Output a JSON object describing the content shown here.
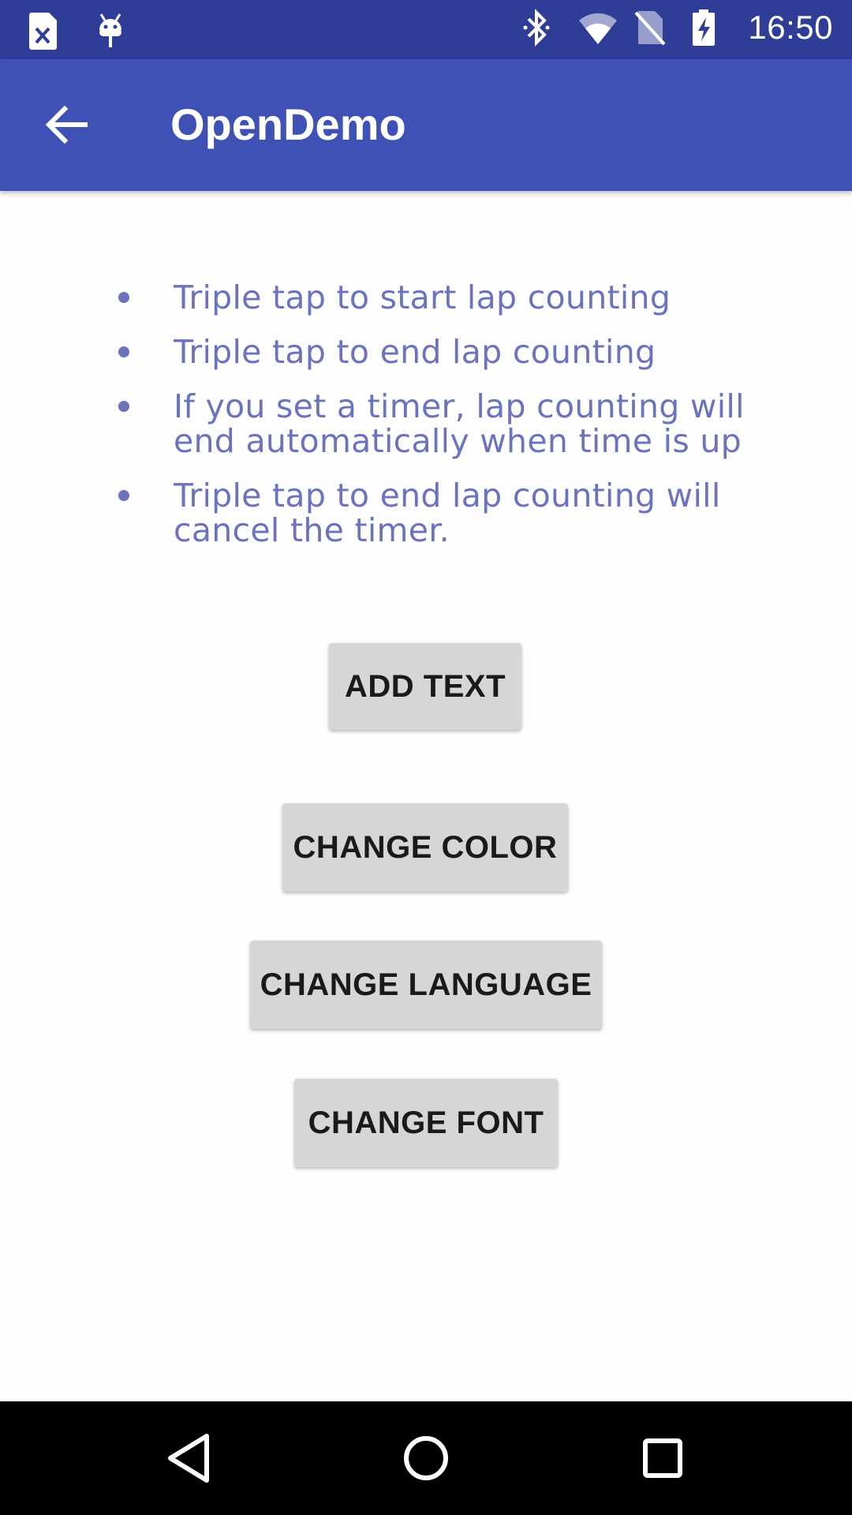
{
  "status_bar": {
    "time": "16:50",
    "icons": [
      "sim-card-icon",
      "android-debug-icon",
      "bluetooth-icon",
      "wifi-icon",
      "no-sim-icon",
      "battery-charging-icon"
    ]
  },
  "app_bar": {
    "title": "OpenDemo",
    "back_icon": "arrow-back-icon"
  },
  "instructions": [
    "Triple tap to start lap counting",
    "Triple tap to end lap counting",
    "If you set a timer, lap counting will end automatically when time is up",
    "Triple tap to end lap counting will cancel the timer."
  ],
  "buttons": {
    "add_text": "ADD TEXT",
    "change_color": "CHANGE COLOR",
    "change_language": "CHANGE LANGUAGE",
    "change_font": "CHANGE FONT"
  },
  "nav_bar": {
    "icons": [
      "nav-back-icon",
      "nav-home-icon",
      "nav-recents-icon"
    ]
  },
  "colors": {
    "status_bar": "#2f3d97",
    "app_bar": "#3f51b5",
    "bullet_text": "#6b73bd",
    "button_bg": "#d6d6d6"
  }
}
